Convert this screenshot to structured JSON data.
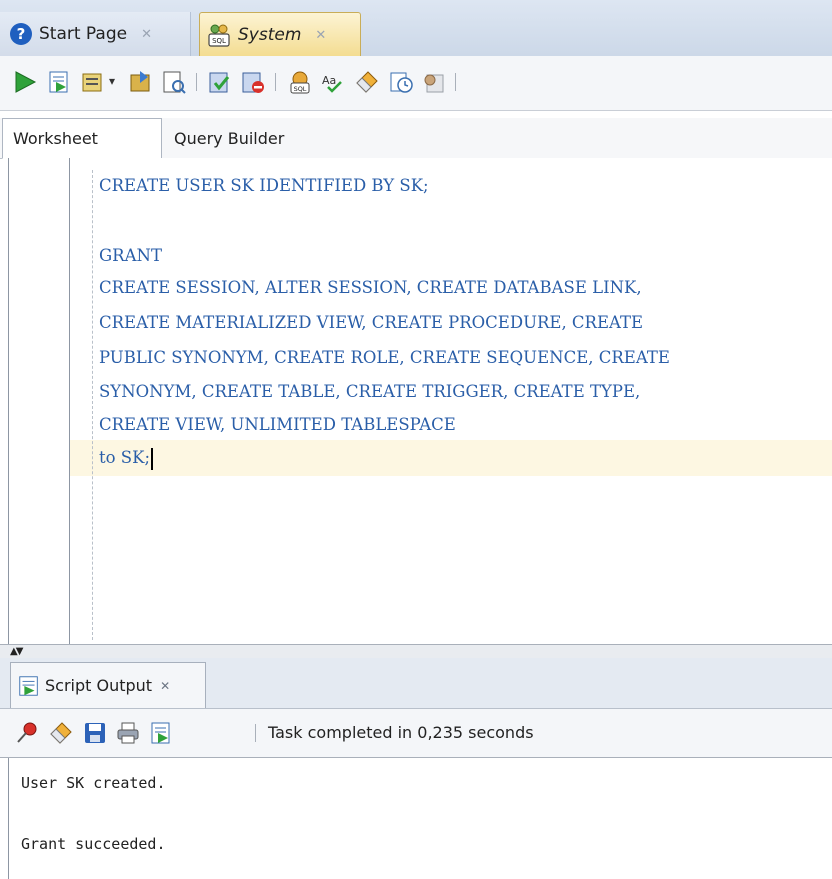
{
  "doc_tabs": [
    {
      "label": "Start Page",
      "icon": "help-icon",
      "active": false
    },
    {
      "label": "System",
      "icon": "sql-worksheet-icon",
      "active": true
    }
  ],
  "toolbar": {
    "buttons": [
      "run-statement-icon",
      "run-script-icon",
      "commit-icon",
      "rollback-icon",
      "explain-plan-icon",
      "autotrace-icon",
      "cancel-icon",
      "sql-tuning-icon",
      "format-icon",
      "clear-icon",
      "history-icon",
      "unshared-worksheet-icon"
    ]
  },
  "worksheet_tabs": [
    {
      "label": "Worksheet",
      "active": true
    },
    {
      "label": "Query Builder",
      "active": false
    }
  ],
  "editor": {
    "lines": [
      "CREATE USER SK IDENTIFIED BY SK;",
      "",
      "GRANT",
      "CREATE SESSION, ALTER SESSION, CREATE DATABASE LINK,",
      "CREATE MATERIALIZED VIEW, CREATE PROCEDURE, CREATE",
      "PUBLIC SYNONYM, CREATE ROLE, CREATE SEQUENCE, CREATE",
      "SYNONYM, CREATE TABLE, CREATE TRIGGER, CREATE TYPE,",
      "CREATE VIEW, UNLIMITED TABLESPACE",
      "to SK;"
    ],
    "keyword_color": "#2a5ea8",
    "current_line_color": "#fdf7e2"
  },
  "output": {
    "tab_label": "Script Output",
    "status": "Task completed in 0,235 seconds",
    "lines": [
      "User SK created.",
      "",
      "Grant succeeded."
    ]
  },
  "colors": {
    "tab_active": "#f3dc90",
    "tab_bar": "#ccd8e8",
    "accent_blue": "#1f5fbf"
  }
}
